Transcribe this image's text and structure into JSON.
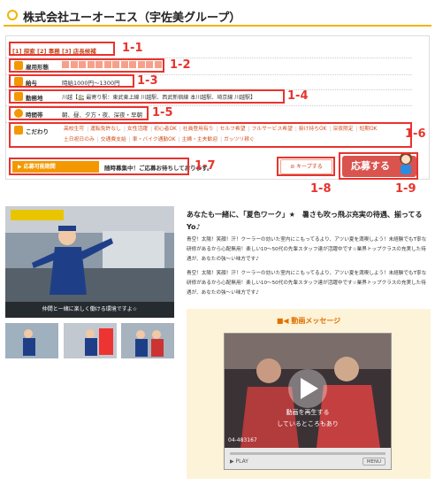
{
  "header": {
    "company": "株式会社ユーオーエス（宇佐美グループ）"
  },
  "rows": {
    "categories": "[1] 探索  [2] 事務  [3] 店長候補",
    "employment_label": "雇用形態",
    "salary_label": "給与",
    "salary_value": "時給1000円〜1300円",
    "station_label": "勤務地",
    "station_value": "川越【🚉 最寄り駅：東武東上線 川越駅、西武新宿線 本川越駅、埼京線 川越駅】",
    "hours_label": "時間帯",
    "hours_value": "朝、昼、夕方・夜、深夜・早朝",
    "kodawari_label": "こだわり",
    "kodawari": [
      "高校生可",
      "運転免許なし",
      "女性活躍",
      "初心者OK",
      "社員登用有り",
      "セルフ希望",
      "フルサービス希望",
      "掛け持ちOK",
      "深夜限定",
      "短期OK",
      "土日祝日のみ",
      "交通費支給",
      "車・バイク通勤OK",
      "主婦・主夫歓迎",
      "ガッツリ稼ぐ"
    ]
  },
  "notice": {
    "badge": "▶ 応募可能期間",
    "text": "随時募集中！ご応募お待ちしております。"
  },
  "buttons": {
    "keep": "キープする",
    "apply": "応募する"
  },
  "annotations": {
    "a11": "1-1",
    "a12": "1-2",
    "a13": "1-3",
    "a14": "1-4",
    "a15": "1-5",
    "a16": "1-6",
    "a17": "1-7",
    "a18": "1-8",
    "a19": "1-9"
  },
  "photo": {
    "caption": "仲間と一緒に楽しく働ける環境ですよ☆"
  },
  "article": {
    "headline": "あなたも一緒に、「夏色ワーク」★　暑さも吹っ飛ぶ充実の待遇、揃ってるYo♪",
    "para1": "青空！太陽！笑顔！汗！クーラーの効いた室内にこもってるより、アツい夏を満喫しよう！未経験でもT寧な研修があるから心配無用！楽しい10〜50代の先輩スタッフ達が活躍中です☆業界トップクラスの充実した待遇が、あなたの強〜い味方です♪",
    "para2": "青空！太陽！笑顔！汗！クーラーの効いた室内にこもってるより、アツい夏を満喫しよう！未経験でもT寧な研修があるから心配無用！楽しい10〜50代の先輩スタッフ達が活躍中です☆業界トップクラスの充実した待遇が、あなたの強〜い味方です♪"
  },
  "video": {
    "title": "動画メッセージ",
    "overlay1": "動画を再生する",
    "overlay2": "しているところもあり",
    "code": "04-483167",
    "play": "PLAY",
    "menu": "MENU"
  }
}
